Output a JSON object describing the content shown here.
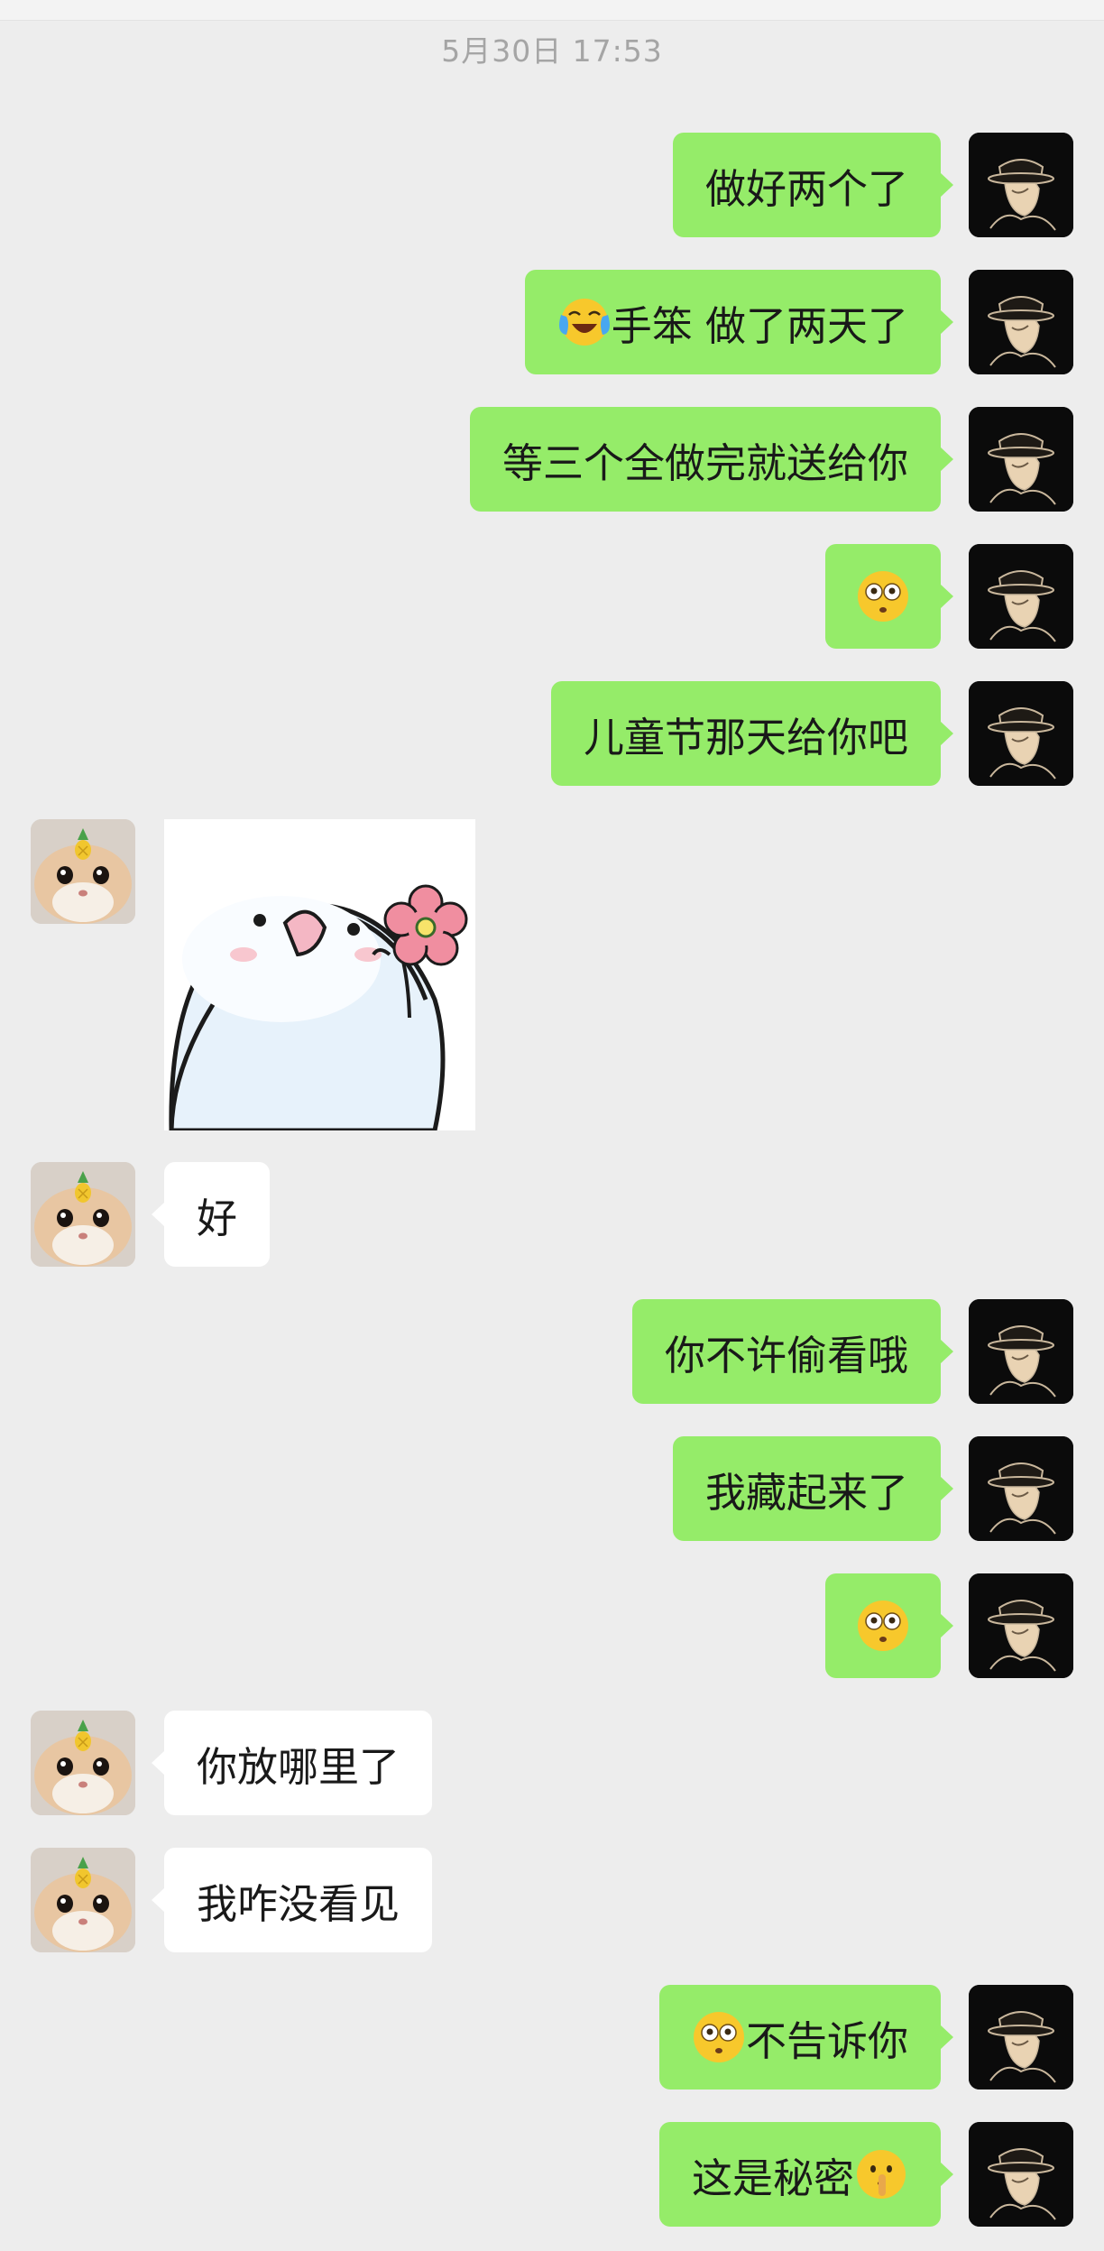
{
  "timestamp": "5月30日 17:53",
  "messages": [
    {
      "side": "mine",
      "text": "做好两个了"
    },
    {
      "side": "mine",
      "emoji_before": "crying-laughing-emoji",
      "text": "手笨 做了两天了"
    },
    {
      "side": "mine",
      "text": "等三个全做完就送给你"
    },
    {
      "side": "mine",
      "emoji": "flushed-face-emoji",
      "text": ""
    },
    {
      "side": "mine",
      "text": "儿童节那天给你吧"
    },
    {
      "side": "theirs",
      "sticker": "bird-with-flower-sticker"
    },
    {
      "side": "theirs",
      "text": "好"
    },
    {
      "side": "mine",
      "text": "你不许偷看哦"
    },
    {
      "side": "mine",
      "text": "我藏起来了"
    },
    {
      "side": "mine",
      "emoji": "flushed-face-emoji",
      "text": ""
    },
    {
      "side": "theirs",
      "text": "你放哪里了"
    },
    {
      "side": "theirs",
      "text": "我咋没看见"
    },
    {
      "side": "mine",
      "emoji_before": "flushed-face-emoji",
      "text": "不告诉你"
    },
    {
      "side": "mine",
      "text": "这是秘密",
      "emoji_after": "shushing-face-emoji"
    }
  ],
  "colors": {
    "background": "#ededed",
    "mine_bubble": "#95ec69",
    "theirs_bubble": "#ffffff",
    "text": "#191919",
    "timestamp": "#a5a5a5"
  },
  "avatars": {
    "mine": "man-in-hat-avatar",
    "theirs": "hamster-with-pineapple-avatar"
  }
}
